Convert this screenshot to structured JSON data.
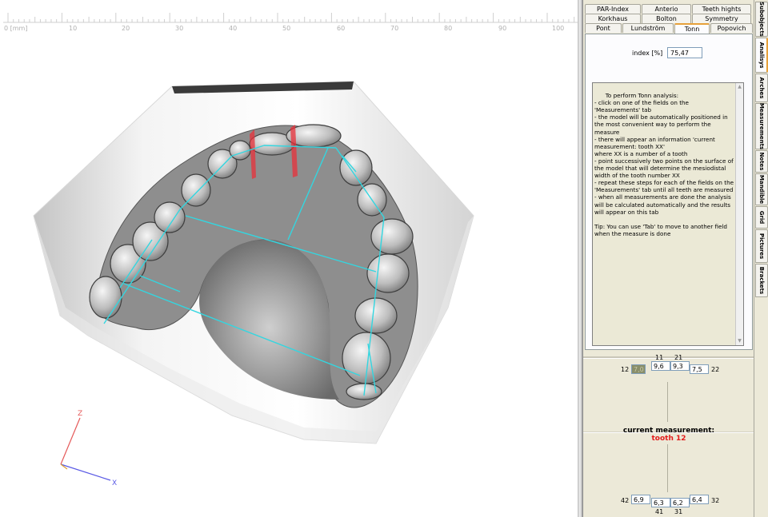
{
  "ruler": {
    "labels": [
      "0 [mm]",
      "10",
      "20",
      "30",
      "40",
      "50",
      "60",
      "70",
      "80",
      "90",
      "100"
    ]
  },
  "axes": {
    "z_label": "Z",
    "x_label": "X"
  },
  "colors": {
    "measure_lines": "#33d6e0",
    "section_planes": "#e8303a",
    "current_tooth": "#e31b1b",
    "active_tab_accent": "#e7a13a"
  },
  "analysis_tabs": {
    "row1": [
      "PAR-Index",
      "Anterio",
      "Teeth hights"
    ],
    "row2": [
      "Korkhaus",
      "Bolton",
      "Symmetry"
    ],
    "row3": [
      "Pont",
      "Lundström",
      "Tonn",
      "Popovich"
    ]
  },
  "tonn": {
    "index_label": "index [%]",
    "index_value": "75,47",
    "instructions": "To perform Tonn analysis:\n- click on one of the fields on the 'Measurements' tab\n- the model will be automatically positioned in the most convenient way to perform the measure\n- there will appear an information 'current measurement: tooth XX'\nwhere XX is a number of a tooth\n- point successively two points on the surface of the model that will determine the mesiodistal width of the tooth number XX\n- repeat these steps for each of the fields on the 'Measurements' tab until all teeth are measured\n- when all measurements are done the analysis will be calculated automatically and the results will appear on this tab\n\nTip: You can use 'Tab' to move to another field when the measure is done"
  },
  "upper_teeth": {
    "n11": "11",
    "n21": "21",
    "n12": "12",
    "n22": "22",
    "v12": "7,0",
    "v11": "9,6",
    "v21": "9,3",
    "v22": "7,5"
  },
  "current": {
    "label": "current measurement:",
    "value": "tooth 12"
  },
  "lower_teeth": {
    "n42": "42",
    "n32": "32",
    "n41": "41",
    "n31": "31",
    "v42": "6,9",
    "v41": "6,3",
    "v31": "6,2",
    "v32": "6,4"
  },
  "side_tabs": [
    "Subobjects",
    "Analisys",
    "Arches",
    "Measurements",
    "Notes",
    "Mandible",
    "Grid",
    "Pictures",
    "Brackets"
  ]
}
